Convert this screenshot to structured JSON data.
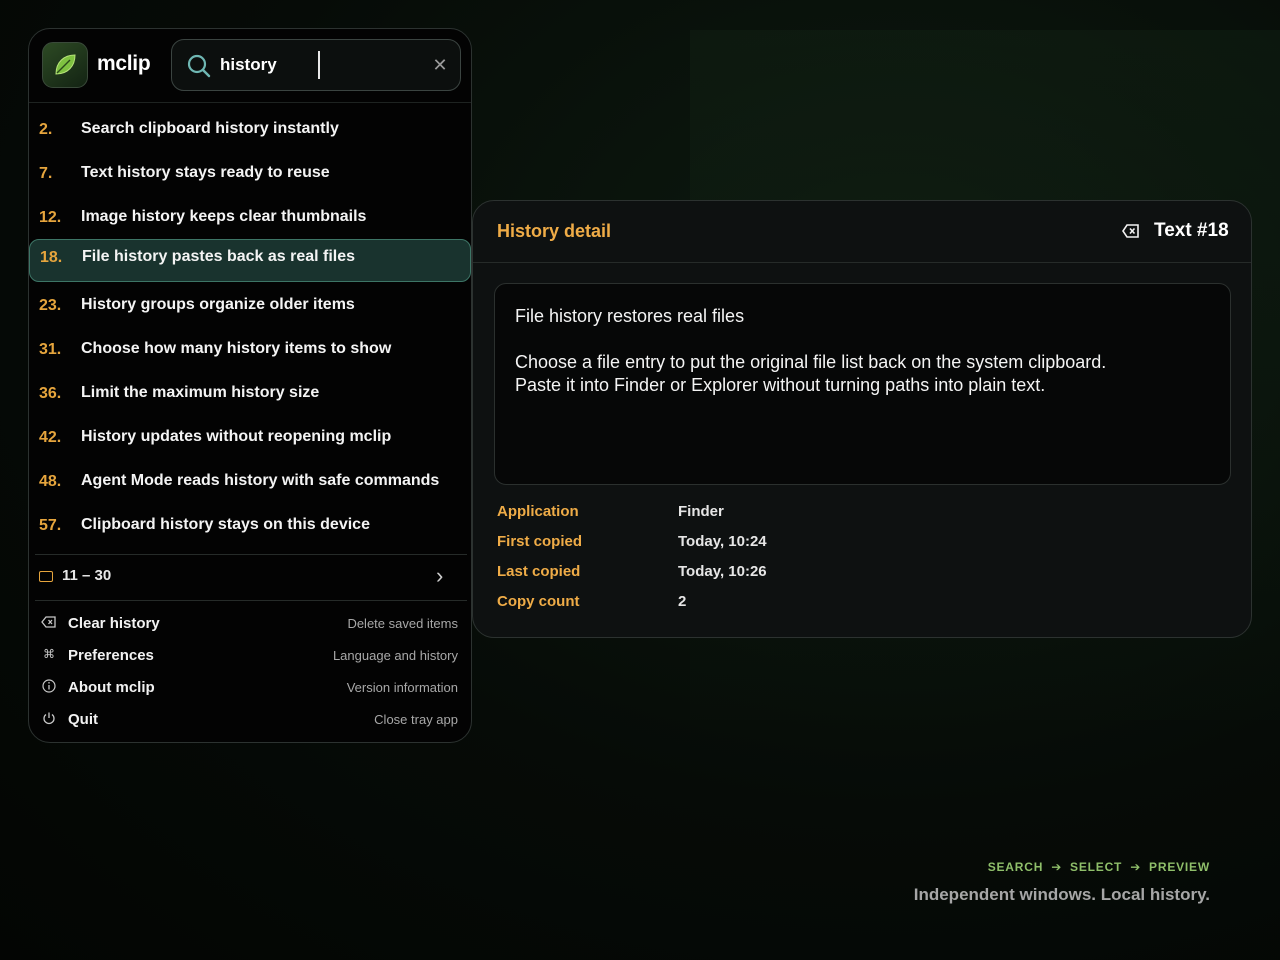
{
  "app": {
    "name": "mclip"
  },
  "search": {
    "value": "history",
    "placeholder": ""
  },
  "results": [
    {
      "num": "2.",
      "text": "Search clipboard history instantly"
    },
    {
      "num": "7.",
      "text": "Text history stays ready to reuse"
    },
    {
      "num": "12.",
      "text": "Image history keeps clear thumbnails"
    },
    {
      "num": "18.",
      "text": "File history pastes back as real files",
      "selected": true
    },
    {
      "num": "23.",
      "text": "History groups organize older items"
    },
    {
      "num": "31.",
      "text": "Choose how many history items to show"
    },
    {
      "num": "36.",
      "text": "Limit the maximum history size"
    },
    {
      "num": "42.",
      "text": "History updates without reopening mclip"
    },
    {
      "num": "48.",
      "text": "Agent Mode reads history with safe commands"
    },
    {
      "num": "57.",
      "text": "Clipboard history stays on this device"
    }
  ],
  "pager": {
    "range": "11 – 30"
  },
  "menu": [
    {
      "label": "Clear history",
      "hint": "Delete saved items",
      "icon": "clear-icon"
    },
    {
      "label": "Preferences",
      "hint": "Language and history",
      "icon": "command-icon"
    },
    {
      "label": "About mclip",
      "hint": "Version information",
      "icon": "info-icon"
    },
    {
      "label": "Quit",
      "hint": "Close tray app",
      "icon": "power-icon"
    }
  ],
  "detail": {
    "title": "History detail",
    "type_label": "Text #18",
    "content": {
      "title": "File history restores real files",
      "lines": [
        "Choose a file entry to put the original file list back on the system clipboard.",
        "Paste it into Finder or Explorer without turning paths into plain text."
      ]
    },
    "meta": [
      {
        "label": "Application",
        "value": "Finder"
      },
      {
        "label": "First copied",
        "value": "Today, 10:24"
      },
      {
        "label": "Last copied",
        "value": "Today, 10:26"
      },
      {
        "label": "Copy count",
        "value": "2"
      }
    ]
  },
  "footer": {
    "steps": [
      "SEARCH",
      "SELECT",
      "PREVIEW"
    ],
    "tagline": "Independent windows. Local history."
  },
  "colors": {
    "accent": "#efac47",
    "selected_bg": "#19332e",
    "selected_border": "#3d7566",
    "step_green": "#8fbf6a"
  }
}
